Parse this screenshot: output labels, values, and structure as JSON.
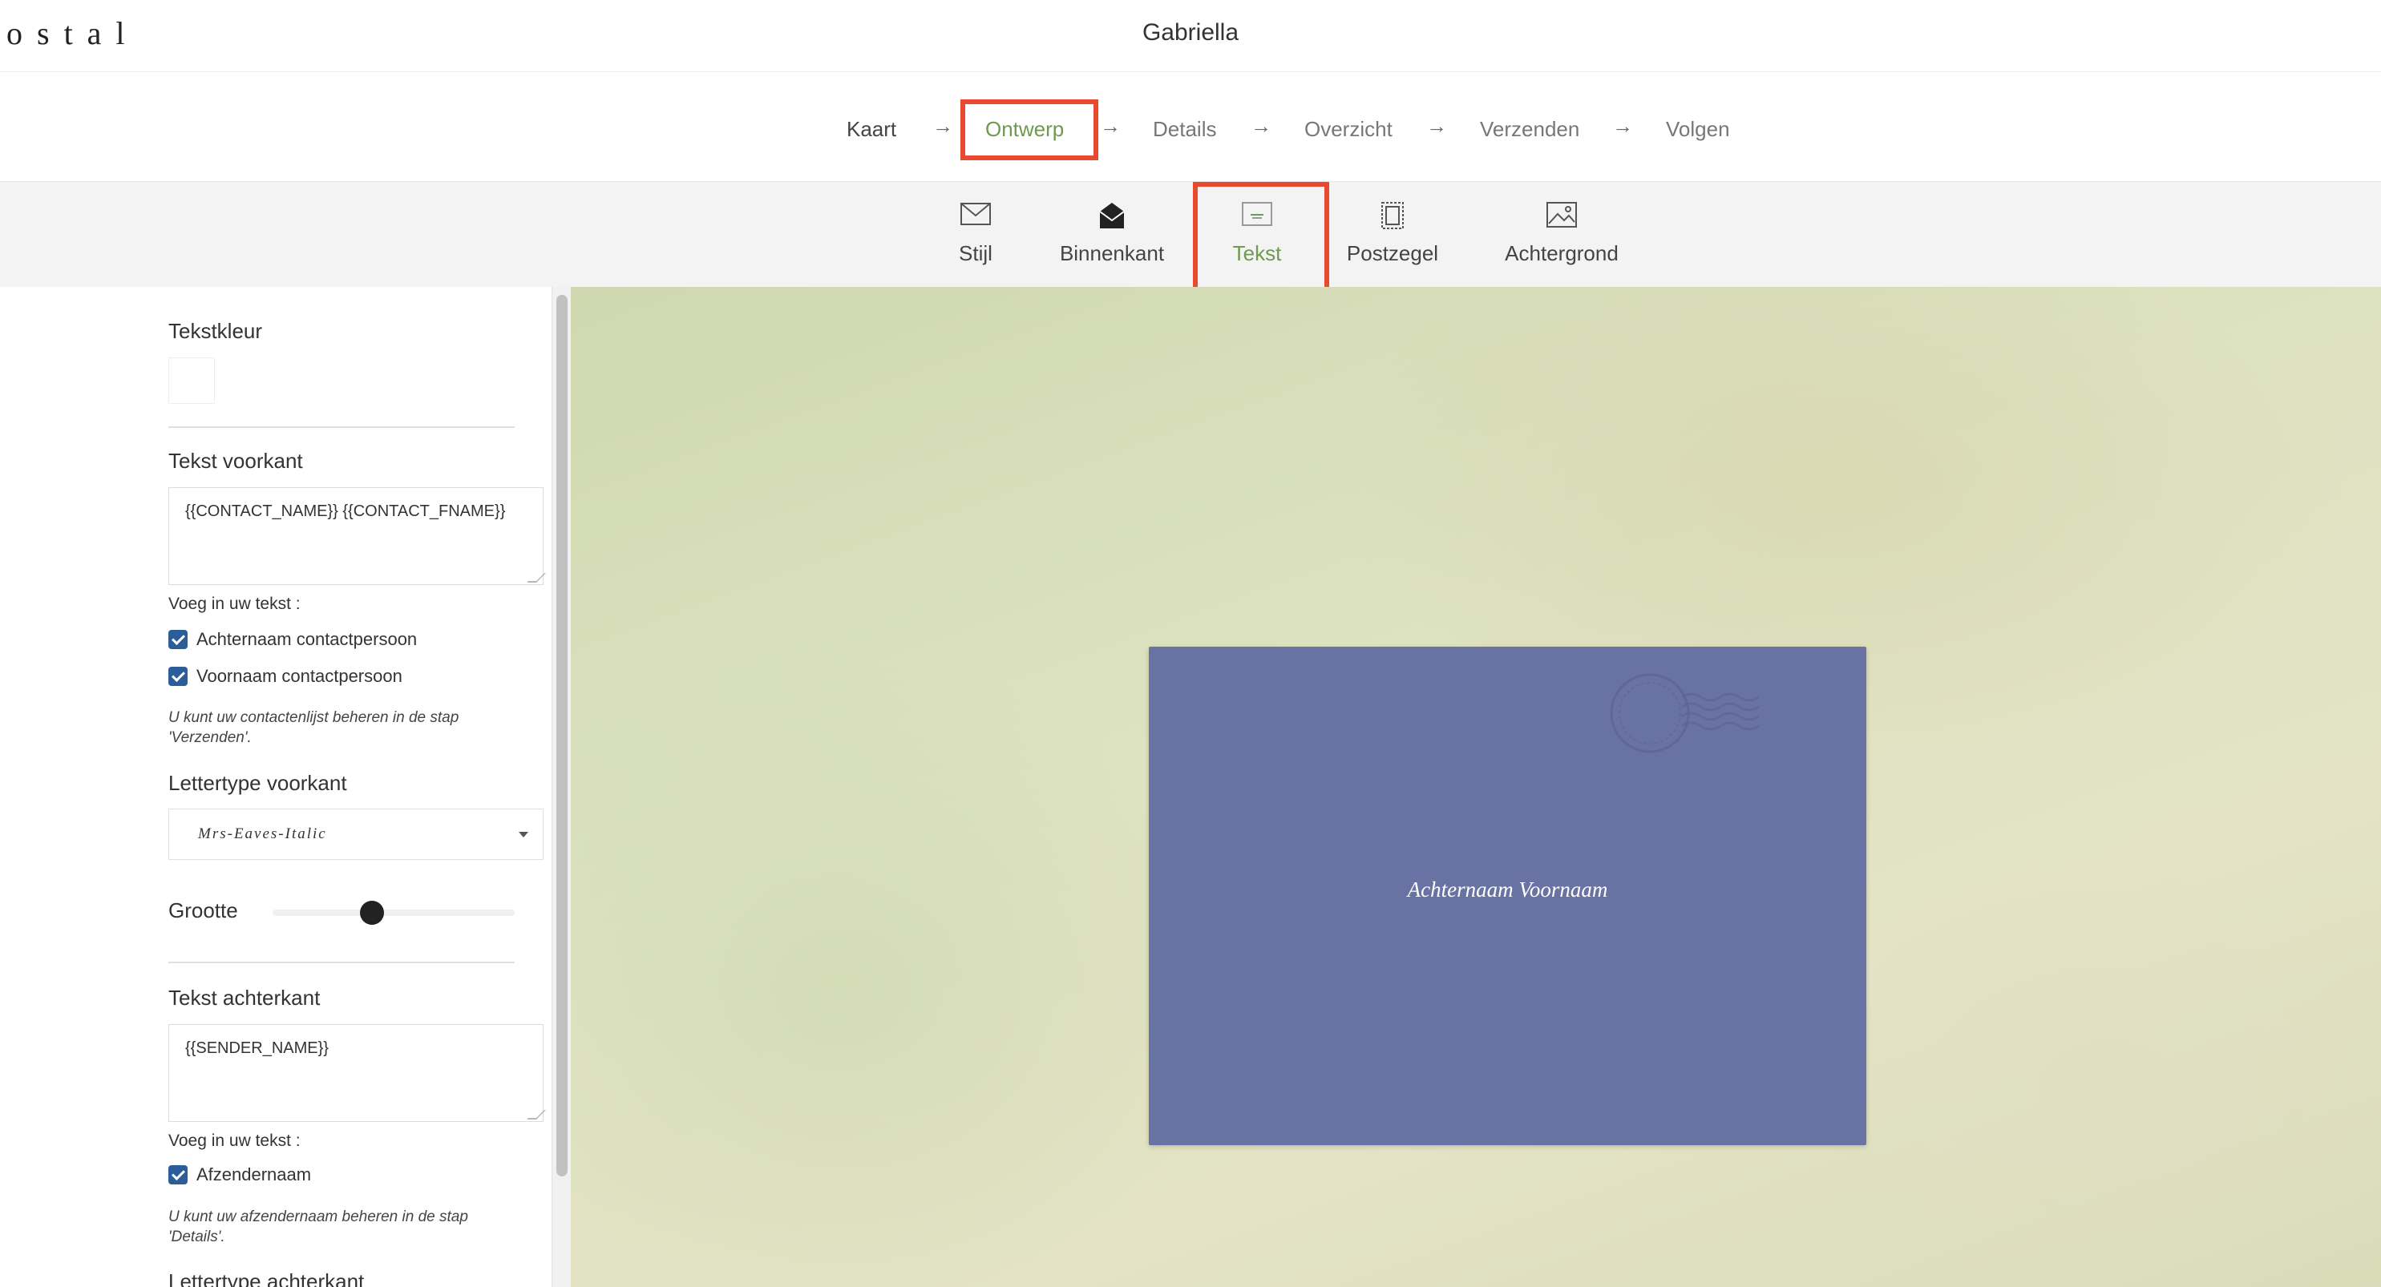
{
  "header": {
    "logo": "ostal",
    "title": "Gabriella"
  },
  "steps": [
    {
      "label": "Kaart",
      "state": "done"
    },
    {
      "label": "Ontwerp",
      "state": "active"
    },
    {
      "label": "Details",
      "state": "todo"
    },
    {
      "label": "Overzicht",
      "state": "todo"
    },
    {
      "label": "Verzenden",
      "state": "todo"
    },
    {
      "label": "Volgen",
      "state": "todo"
    }
  ],
  "step_arrow": "→",
  "tools": [
    {
      "label": "Stijl",
      "icon": "envelope-icon"
    },
    {
      "label": "Binnenkant",
      "icon": "envelope-inside-icon"
    },
    {
      "label": "Tekst",
      "icon": "text-icon",
      "active": true
    },
    {
      "label": "Postzegel",
      "icon": "stamp-icon"
    },
    {
      "label": "Achtergrond",
      "icon": "image-icon"
    }
  ],
  "panel": {
    "text_color_label": "Tekstkleur",
    "text_color_value": "#ffffff",
    "front_text_label": "Tekst voorkant",
    "front_text_value": "{{CONTACT_NAME}}  {{CONTACT_FNAME}}",
    "insert_label": "Voeg in uw tekst :",
    "front_checkboxes": [
      {
        "label": "Achternaam contactpersoon",
        "checked": true
      },
      {
        "label": "Voornaam contactpersoon",
        "checked": true
      }
    ],
    "front_note": "U kunt uw contactenlijst beheren in de stap 'Verzenden'.",
    "front_font_label": "Lettertype voorkant",
    "front_font_value": "Mrs-Eaves-Italic",
    "size_label": "Grootte",
    "back_text_label": "Tekst achterkant",
    "back_text_value": "{{SENDER_NAME}}",
    "back_insert_label": "Voeg in uw tekst :",
    "back_checkboxes": [
      {
        "label": "Afzendernaam",
        "checked": true
      }
    ],
    "back_note": "U kunt uw afzendernaam beheren in de stap 'Details'.",
    "back_font_label": "Lettertype achterkant"
  },
  "envelope": {
    "text": "Achternaam Voornaam",
    "color": "#6973a3"
  },
  "colors": {
    "accent": "#6e9a4f",
    "highlight": "#e8492f",
    "checkbox": "#2a5d9a"
  }
}
